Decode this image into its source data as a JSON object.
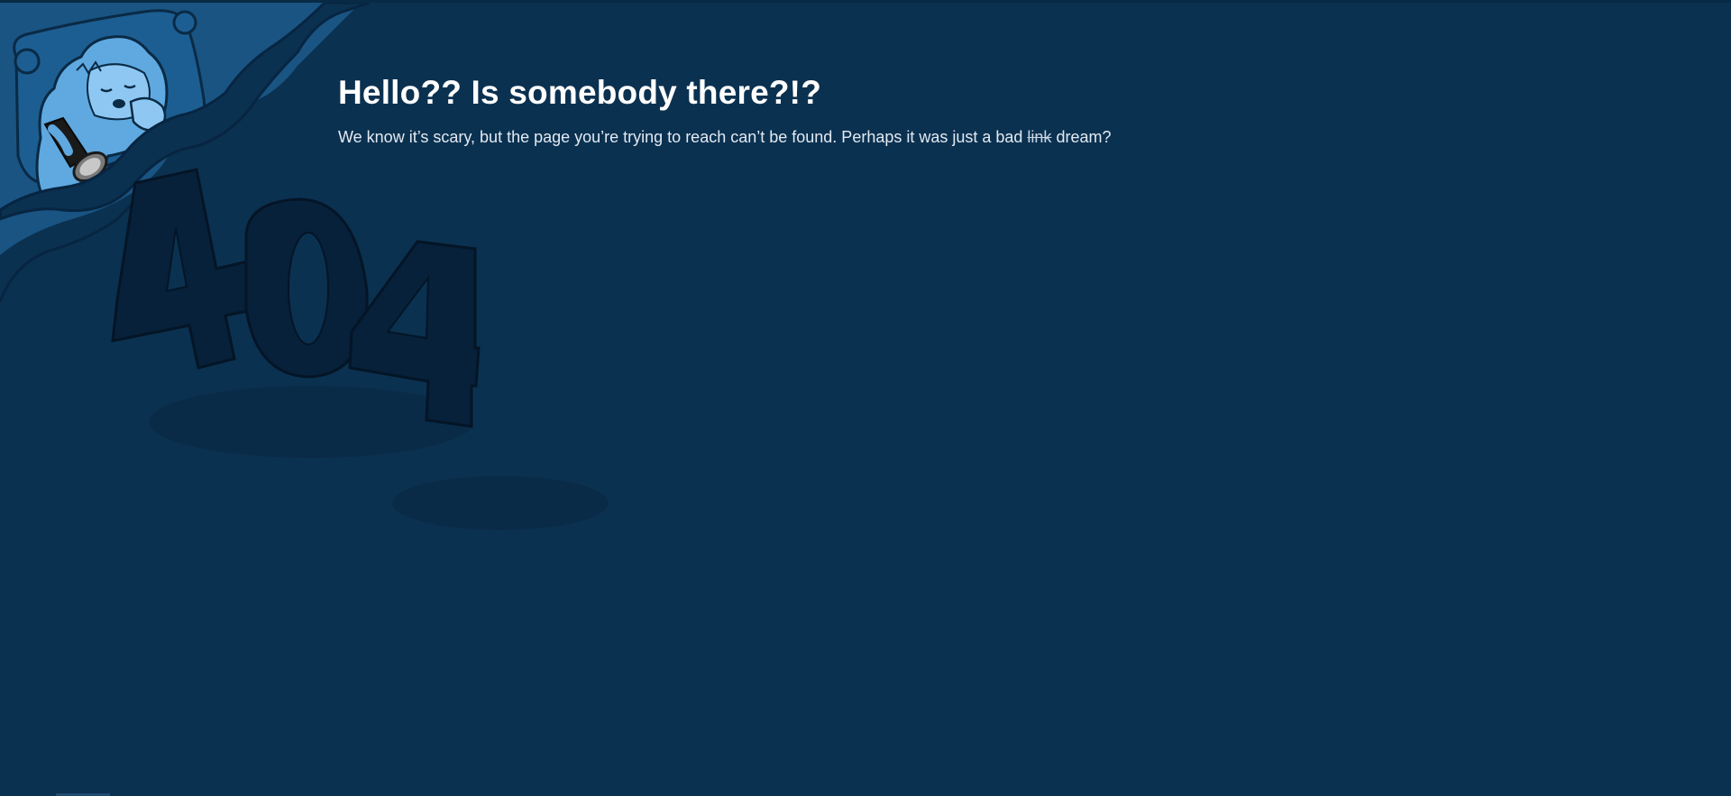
{
  "heading": "Hello?? Is somebody there?!?",
  "message": {
    "before": "We know it’s scary, but the page you’re trying to reach can’t be found. Perhaps it was just a bad ",
    "struck": "link",
    "after": " dream?"
  },
  "illustration": {
    "graphic_text": "404",
    "icons": [
      "yeti-mascot-icon",
      "flashlight-icon",
      "pillow-icon",
      "blanket-icon"
    ]
  },
  "colors": {
    "background": "#0b3150",
    "heading": "#ffffff",
    "body_text": "#e2eaf2",
    "mascot": "#5fa9e0",
    "numerals": "#07213a"
  }
}
